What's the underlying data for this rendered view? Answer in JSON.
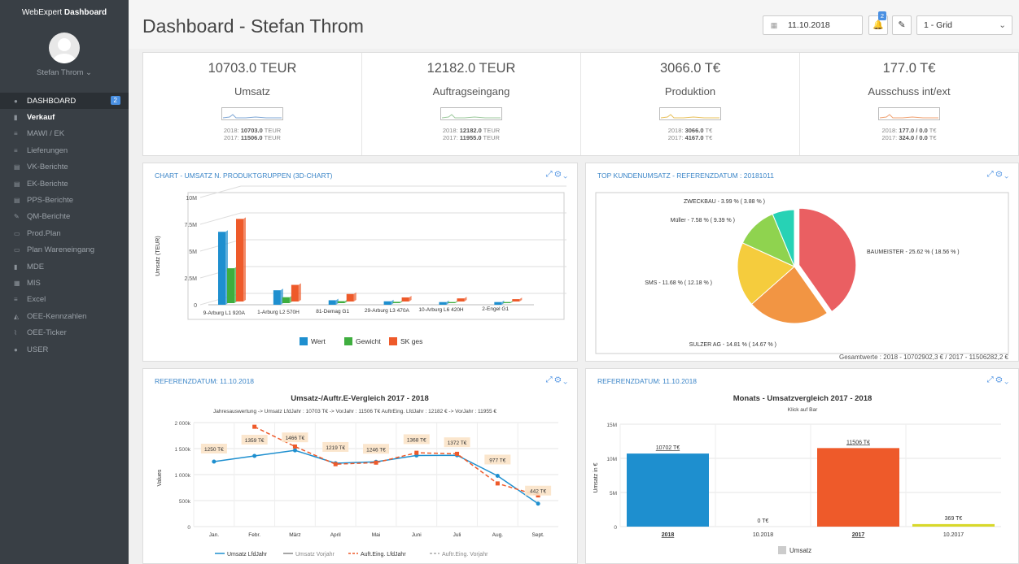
{
  "sidebar": {
    "brand_prefix": "WebExpert",
    "brand_strong": "Dashboard",
    "user": "Stefan Throm ⌄",
    "items": [
      {
        "label": "DASHBOARD",
        "icon": "dashboard-icon",
        "badge": "2"
      },
      {
        "label": "Verkauf",
        "icon": "bar-chart-icon"
      },
      {
        "label": "MAWI / EK",
        "icon": "list-icon"
      },
      {
        "label": "Lieferungen",
        "icon": "list-icon"
      },
      {
        "label": "VK-Berichte",
        "icon": "file-icon"
      },
      {
        "label": "EK-Berichte",
        "icon": "file-icon"
      },
      {
        "label": "PPS-Berichte",
        "icon": "file-icon"
      },
      {
        "label": "QM-Berichte",
        "icon": "wrench-icon"
      },
      {
        "label": "Prod.Plan",
        "icon": "calendar-icon"
      },
      {
        "label": "Plan Wareneingang",
        "icon": "calendar-icon"
      },
      {
        "label": "MDE",
        "icon": "book-icon"
      },
      {
        "label": "MIS",
        "icon": "table-icon"
      },
      {
        "label": "Excel",
        "icon": "list-icon"
      },
      {
        "label": "OEE-Kennzahlen",
        "icon": "area-chart-icon"
      },
      {
        "label": "OEE-Ticker",
        "icon": "line-chart-icon"
      },
      {
        "label": "USER",
        "icon": "user-icon"
      }
    ]
  },
  "header": {
    "title": "Dashboard - Stefan Throm",
    "date": "11.10.2018",
    "notifications": "2",
    "layout_select": "1 - Grid"
  },
  "kpis": [
    {
      "value": "10703.0 TEUR",
      "label": "Umsatz",
      "y2018_label": "2018:",
      "y2018": "10703.0",
      "y2018_unit": "TEUR",
      "y2017_label": "2017:",
      "y2017": "11506.0",
      "y2017_unit": "TEUR",
      "spark": "#7fa7d6"
    },
    {
      "value": "12182.0 TEUR",
      "label": "Auftragseingang",
      "y2018_label": "2018:",
      "y2018": "12182.0",
      "y2018_unit": "TEUR",
      "y2017_label": "2017:",
      "y2017": "11955.0",
      "y2017_unit": "TEUR",
      "spark": "#9cc99c"
    },
    {
      "value": "3066.0 T€",
      "label": "Produktion",
      "y2018_label": "2018:",
      "y2018": "3066.0",
      "y2018_unit": "T€",
      "y2017_label": "2017:",
      "y2017": "4167.0",
      "y2017_unit": "T€",
      "spark": "#e8c05a"
    },
    {
      "value": "177.0 T€",
      "label": "Ausschuss int/ext",
      "y2018_label": "2018:",
      "y2018": "177.0 / 0.0",
      "y2018_unit": "T€",
      "y2017_label": "2017:",
      "y2017": "324.0 / 0.0",
      "y2017_unit": "T€",
      "spark": "#f0a070"
    }
  ],
  "panels": {
    "p1_title": "CHART - UMSATZ N. PRODUKTGRUPPEN (3D-CHART)",
    "p2_title": "TOP KUNDENUMSATZ - REFERENZDATUM : 20181011",
    "p3_title": "REFERENZDATUM: 11.10.2018",
    "p4_title": "REFERENZDATUM: 11.10.2018",
    "tools": "⤢   ⚙ ⌄"
  },
  "chart_data": [
    {
      "type": "bar",
      "ylabel": "Umsatz (TEUR)",
      "ylim": [
        0,
        10000000
      ],
      "yticks": [
        "0",
        "2.5M",
        "5M",
        "7.5M",
        "10M"
      ],
      "categories": [
        "9-Arburg L1 920A",
        "1-Arburg L2 570H",
        "81-Demag G1",
        "29-Arburg L3 470A",
        "10-Arburg L6 420H",
        "2-Engel G1"
      ],
      "series": [
        {
          "name": "Wert",
          "color": "#1e8fcf",
          "values": [
            6800000,
            1350000,
            420000,
            320000,
            250000,
            250000
          ]
        },
        {
          "name": "Gewicht",
          "color": "#3fae3f",
          "values": [
            3250000,
            550000,
            180000,
            120000,
            100000,
            100000
          ]
        },
        {
          "name": "SK ges",
          "color": "#ee5a2a",
          "values": [
            7700000,
            1550000,
            700000,
            380000,
            290000,
            220000
          ]
        }
      ]
    },
    {
      "type": "pie",
      "slices": [
        {
          "label": "BAUMEISTER - 25.62 % ( 18.56 % )",
          "value": 25.62,
          "color": "#ea5f62"
        },
        {
          "label": "SULZER AG - 14.81 % ( 14.67 % )",
          "value": 14.81,
          "color": "#f29543"
        },
        {
          "label": "SMS - 11.68 % ( 12.18 % )",
          "value": 11.68,
          "color": "#f5cc3d"
        },
        {
          "label": "Müller - 7.58 % ( 9.39 % )",
          "value": 7.58,
          "color": "#8fd34f"
        },
        {
          "label": "ZWECKBAU - 3.99 % ( 3.88 % )",
          "value": 3.99,
          "color": "#27d2b5"
        }
      ],
      "footer": "Gesamtwerte : 2018 - 10702902,3 € / 2017 - 11506282,2 €"
    },
    {
      "type": "line",
      "title": "Umsatz-/Auftr.E-Vergleich 2017 - 2018",
      "subtitle": "Jahresauswertung -> Umsatz LfdJahr : 10703 T€ -> VorJahr : 11506 T€ AuftrEing. LfdJahr : 12182 € -> VorJahr : 11955 €",
      "ylabel": "Values",
      "ylim": [
        0,
        2000000
      ],
      "yticks": [
        "0",
        "500k",
        "1 000k",
        "1 500k",
        "2 000k"
      ],
      "categories": [
        "Jan.",
        "Febr.",
        "März",
        "April",
        "Mai",
        "Juni",
        "Juli",
        "Aug.",
        "Sept."
      ],
      "series": [
        {
          "name": "Umsatz LfdJahr",
          "color": "#1e8fcf",
          "values": [
            1250000,
            1359000,
            1466000,
            1219000,
            1246000,
            1368000,
            1372000,
            977000,
            442000
          ]
        },
        {
          "name": "Umsatz Vorjahr",
          "color": "#888888",
          "values": [
            null,
            null,
            null,
            null,
            null,
            null,
            null,
            null,
            null
          ]
        },
        {
          "name": "Auft.Eing. LfdJahr",
          "color": "#ee5a2a",
          "values": [
            null,
            1920000,
            1540000,
            1200000,
            1230000,
            1420000,
            1400000,
            830000,
            600000
          ]
        },
        {
          "name": "Auftr.Eing. Vorjahr",
          "color": "#aaaaaa",
          "values": [
            null,
            null,
            null,
            null,
            null,
            null,
            null,
            null,
            null
          ]
        }
      ],
      "labels": [
        "1250 T€",
        "1359 T€",
        "1466 T€",
        "1219 T€",
        "1246 T€",
        "1368 T€",
        "1372 T€",
        "977 T€",
        "442 T€"
      ]
    },
    {
      "type": "bar",
      "title": "Monats - Umsatzvergleich 2017 - 2018",
      "subtitle": "Klick auf Bar",
      "ylabel": "Umsatz in €",
      "ylim": [
        0,
        15000000
      ],
      "yticks": [
        "0",
        "5M",
        "10M",
        "15M"
      ],
      "categories": [
        "2018",
        "10.2018",
        "2017",
        "10.2017"
      ],
      "values": [
        10702000,
        0,
        11506000,
        369000
      ],
      "colors": [
        "#1e8fcf",
        "#1e8fcf",
        "#ee5a2a",
        "#d8d82a"
      ],
      "data_labels": [
        "10702 T€",
        "0 T€",
        "11506 T€",
        "369 T€"
      ],
      "legend": "Umsatz"
    }
  ]
}
